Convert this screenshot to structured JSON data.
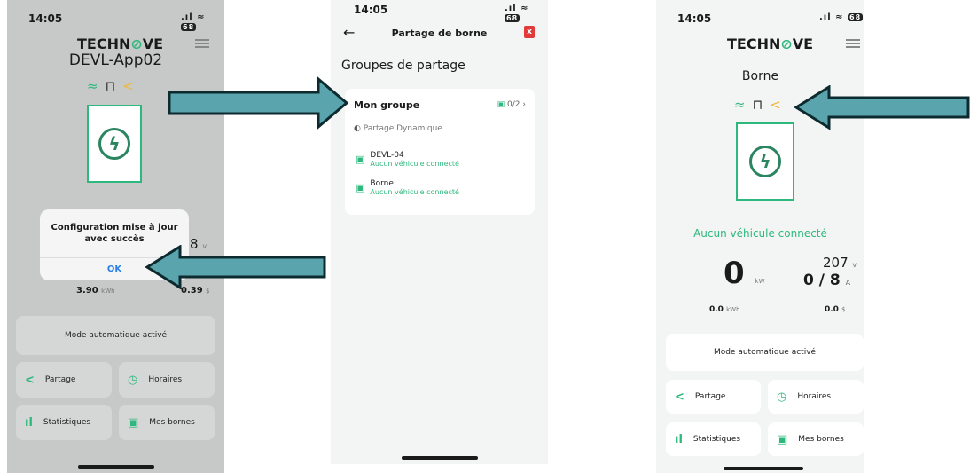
{
  "screen1": {
    "time": "14:05",
    "logo_prefix": "TECHN",
    "logo_o": "⊘",
    "logo_suffix": "VE",
    "charger_name": "DEVL-App02",
    "dialog": {
      "message": "Configuration mise à jour\navec succès",
      "ok": "OK"
    },
    "voltage_partial": "8",
    "voltage_unit": "v",
    "energy": "3.90",
    "energy_unit": "kWh",
    "cost": "0.39",
    "cost_unit": "$",
    "mode": "Mode automatique activé",
    "buttons": {
      "partage": "Partage",
      "horaires": "Horaires",
      "statistiques": "Statistiques",
      "mes_bornes": "Mes bornes"
    }
  },
  "screen2": {
    "time": "14:05",
    "title": "Partage de borne",
    "section_title": "Groupes de partage",
    "group": {
      "name": "Mon groupe",
      "count": "0/2",
      "mode": "Partage Dynamique",
      "members": [
        {
          "name": "DEVL-04",
          "status": "Aucun véhicule connecté"
        },
        {
          "name": "Borne",
          "status": "Aucun véhicule connecté"
        }
      ]
    }
  },
  "screen3": {
    "time": "14:05",
    "logo_prefix": "TECHN",
    "logo_o": "⊘",
    "logo_suffix": "VE",
    "charger_name": "Borne",
    "status_text": "Aucun véhicule connecté",
    "power": "0",
    "power_unit": "kW",
    "voltage": "207",
    "voltage_unit": "v",
    "current": "0 / 8",
    "current_unit": "A",
    "energy": "0.0",
    "energy_unit": "kWh",
    "cost": "0.0",
    "cost_unit": "$",
    "mode": "Mode automatique activé",
    "buttons": {
      "partage": "Partage",
      "horaires": "Horaires",
      "statistiques": "Statistiques",
      "mes_bornes": "Mes bornes"
    }
  },
  "colors": {
    "accent": "#2db87d",
    "share": "#f0b93b",
    "arrow_fill": "#5aa5ad",
    "arrow_stroke": "#0d2a2f",
    "danger": "#e03a3a",
    "link": "#2a7ee8"
  }
}
